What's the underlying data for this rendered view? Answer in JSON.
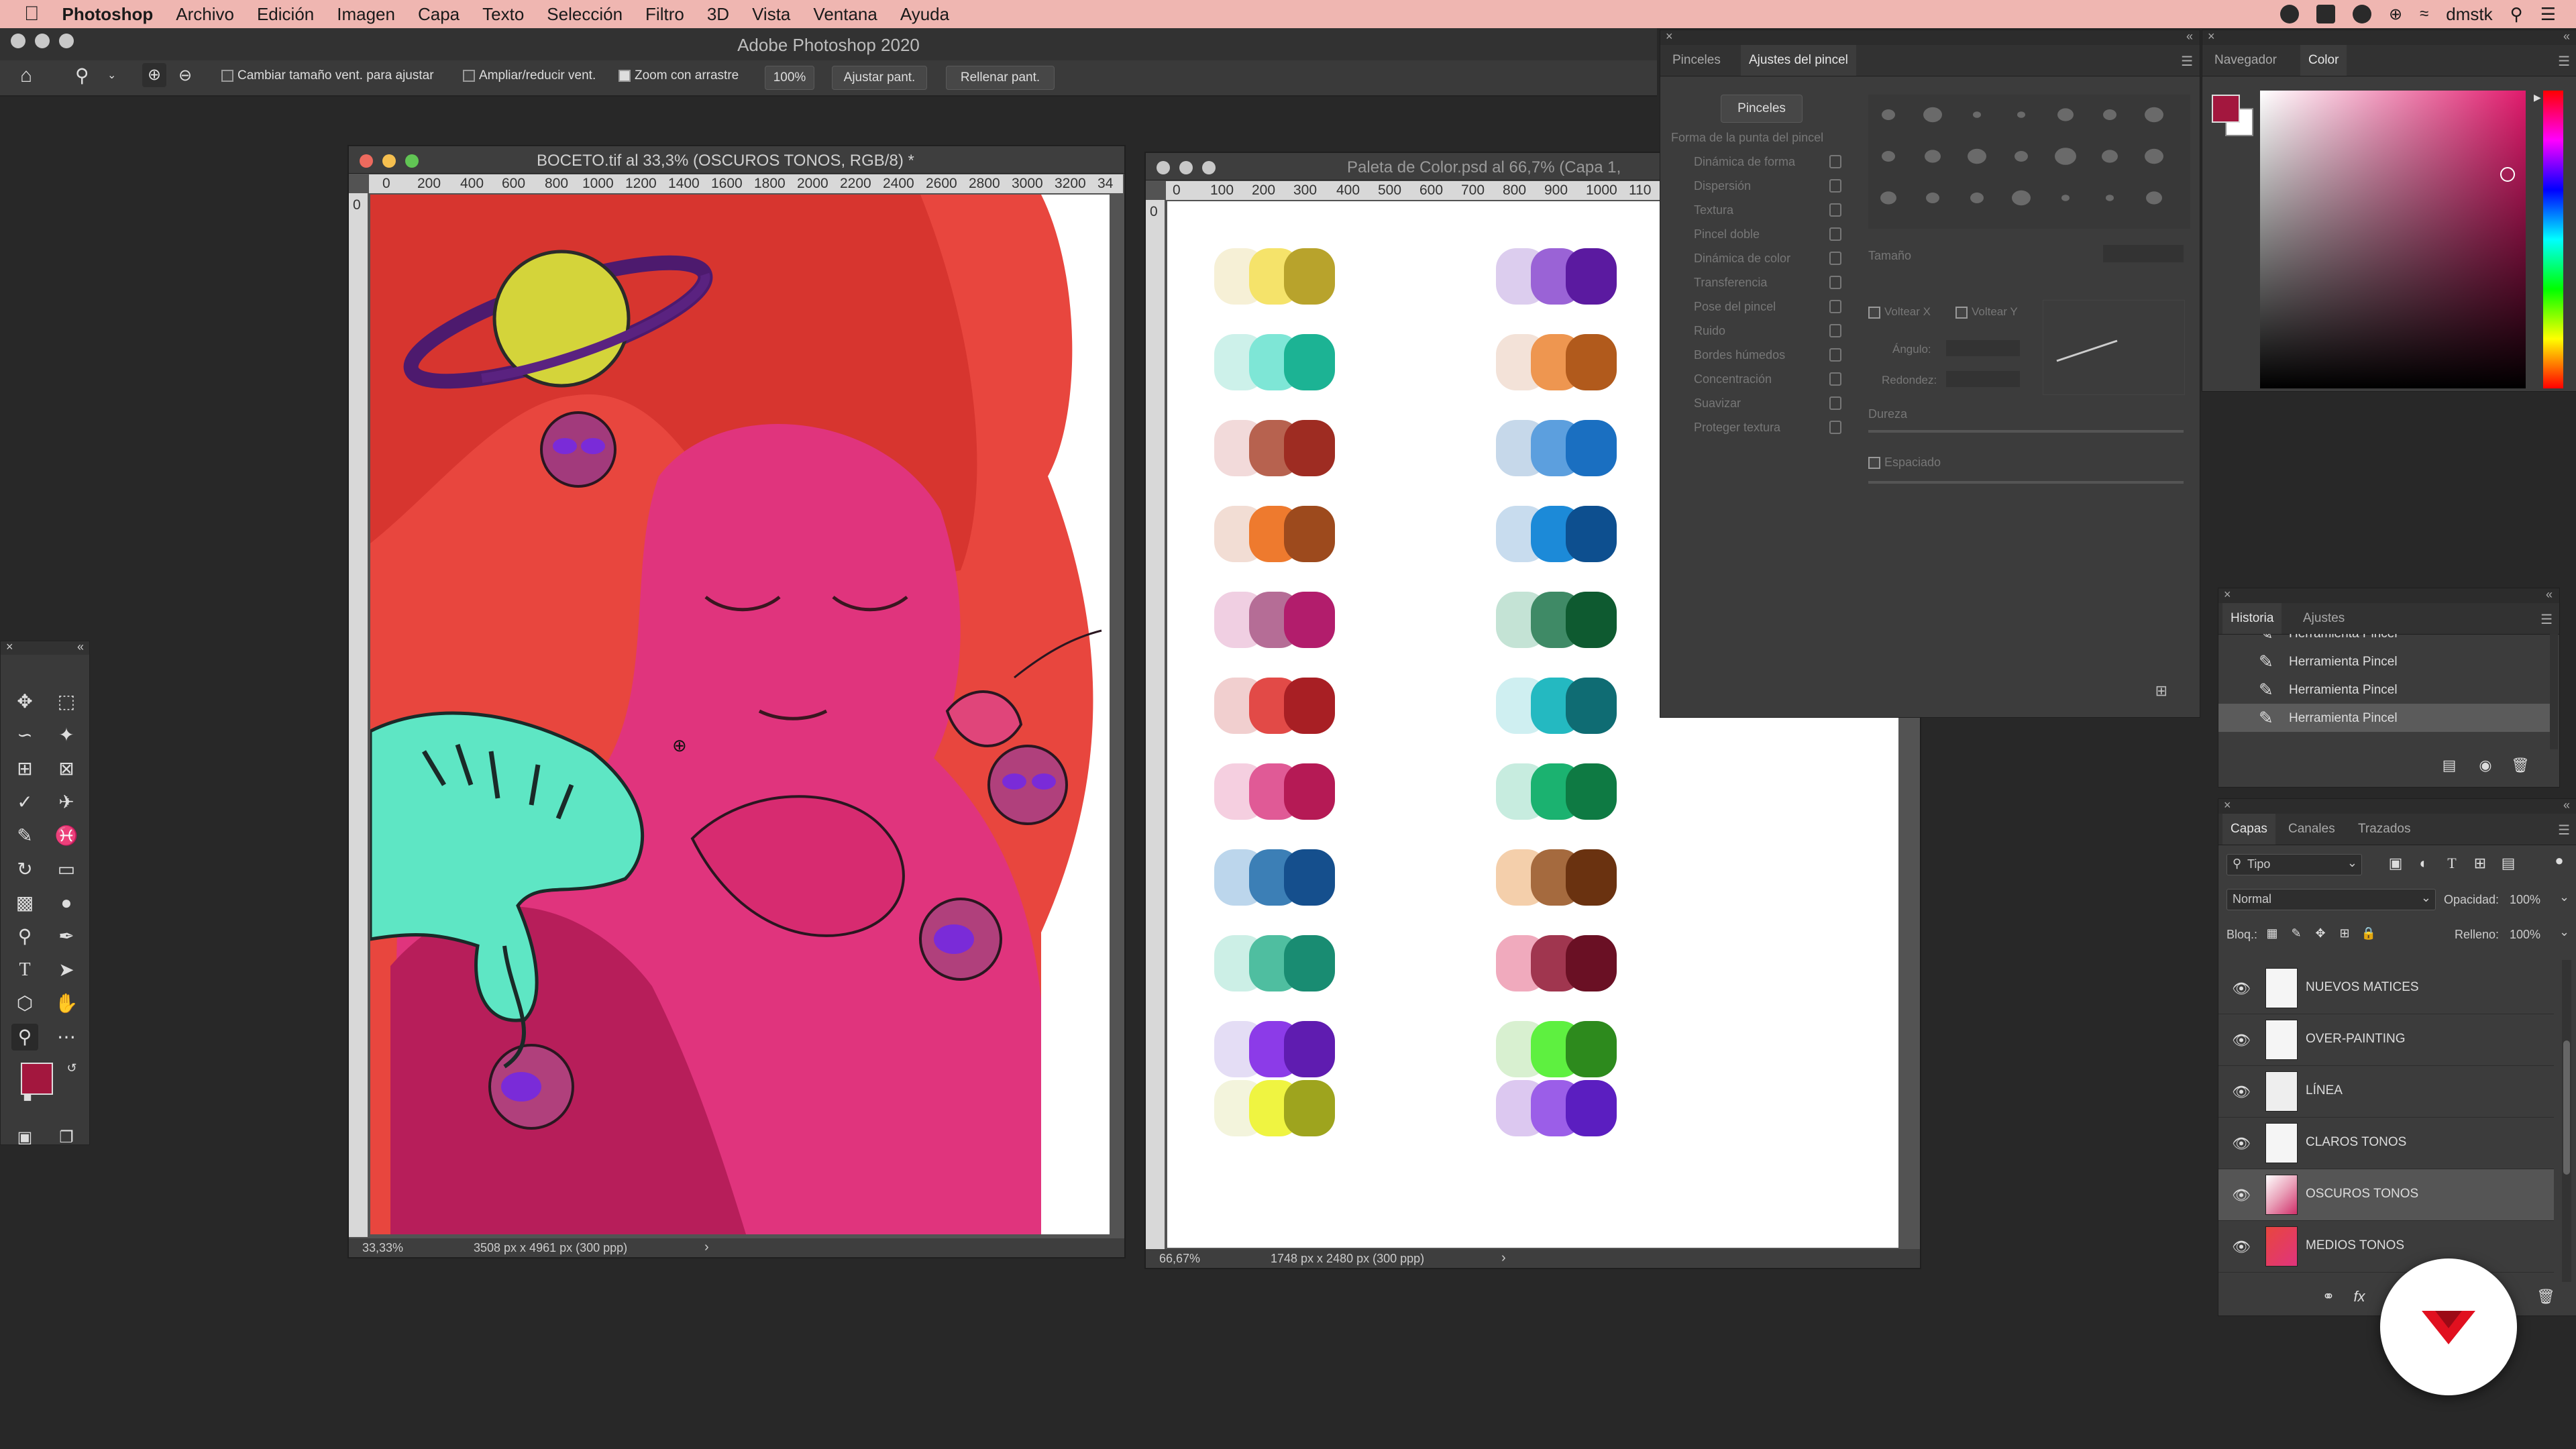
{
  "menubar": {
    "apple": "",
    "app": "Photoshop",
    "items": [
      "Archivo",
      "Edición",
      "Imagen",
      "Capa",
      "Texto",
      "Selección",
      "Filtro",
      "3D",
      "Vista",
      "Ventana",
      "Ayuda"
    ],
    "user": "dmstk"
  },
  "app_title": "Adobe Photoshop 2020",
  "options_bar": {
    "resize_windows_label": "Cambiar tamaño vent. para ajustar",
    "zoom_all_label": "Ampliar/reducir vent.",
    "scrubby_zoom_label": "Zoom con arrastre",
    "zoom_value": "100%",
    "fit_screen": "Ajustar pant.",
    "fill_screen": "Rellenar pant."
  },
  "doc1": {
    "title": "BOCETO.tif al 33,3% (OSCUROS TONOS, RGB/8) *",
    "ruler_ticks": [
      "0",
      "200",
      "400",
      "600",
      "800",
      "1000",
      "1200",
      "1400",
      "1600",
      "1800",
      "2000",
      "2200",
      "2400",
      "2600",
      "2800",
      "3000",
      "3200",
      "34"
    ],
    "zoom": "33,33%",
    "info": "3508 px x 4961 px (300 ppp)"
  },
  "doc2": {
    "title": "Paleta de Color.psd al 66,7% (Capa 1,",
    "ruler_ticks": [
      "0",
      "100",
      "200",
      "300",
      "400",
      "500",
      "600",
      "700",
      "800",
      "900",
      "1000",
      "110"
    ],
    "zoom": "66,67%",
    "info": "1748 px x 2480 px (300 ppp)"
  },
  "brush_panel": {
    "tabs": [
      "Pinceles",
      "Ajustes del pincel"
    ],
    "brushes_button": "Pinceles",
    "rows": [
      "Forma de la punta del pincel",
      "Dinámica de forma",
      "Dispersión",
      "Textura",
      "Pincel doble",
      "Dinámica de color",
      "Transferencia",
      "Pose del pincel",
      "Ruido",
      "Bordes húmedos",
      "Concentración",
      "Suavizar",
      "Proteger textura"
    ],
    "size_label": "Tamaño",
    "flip_x": "Voltear X",
    "flip_y": "Voltear Y",
    "angle": "Ángulo:",
    "roundness": "Redondez:",
    "hardness": "Dureza",
    "spacing": "Espaciado"
  },
  "color_panel": {
    "tabs": [
      "Navegador",
      "Color"
    ],
    "foreground": "#a3173e",
    "background": "#ffffff"
  },
  "history_panel": {
    "tabs": [
      "Historia",
      "Ajustes"
    ],
    "items": [
      "Herramienta Pincel",
      "Herramienta Pincel",
      "Herramienta Pincel",
      "Herramienta Pincel"
    ]
  },
  "layers_panel": {
    "tabs": [
      "Capas",
      "Canales",
      "Trazados"
    ],
    "filter": "Tipo",
    "blend_mode": "Normal",
    "opacity_label": "Opacidad:",
    "opacity": "100%",
    "lock_label": "Bloq.:",
    "fill_label": "Relleno:",
    "fill": "100%",
    "layers": [
      "NUEVOS MATICES",
      "OVER-PAINTING",
      "LÍNEA",
      "CLAROS TONOS",
      "OSCUROS TONOS",
      "MEDIOS TONOS"
    ],
    "selected": "OSCUROS TONOS"
  }
}
